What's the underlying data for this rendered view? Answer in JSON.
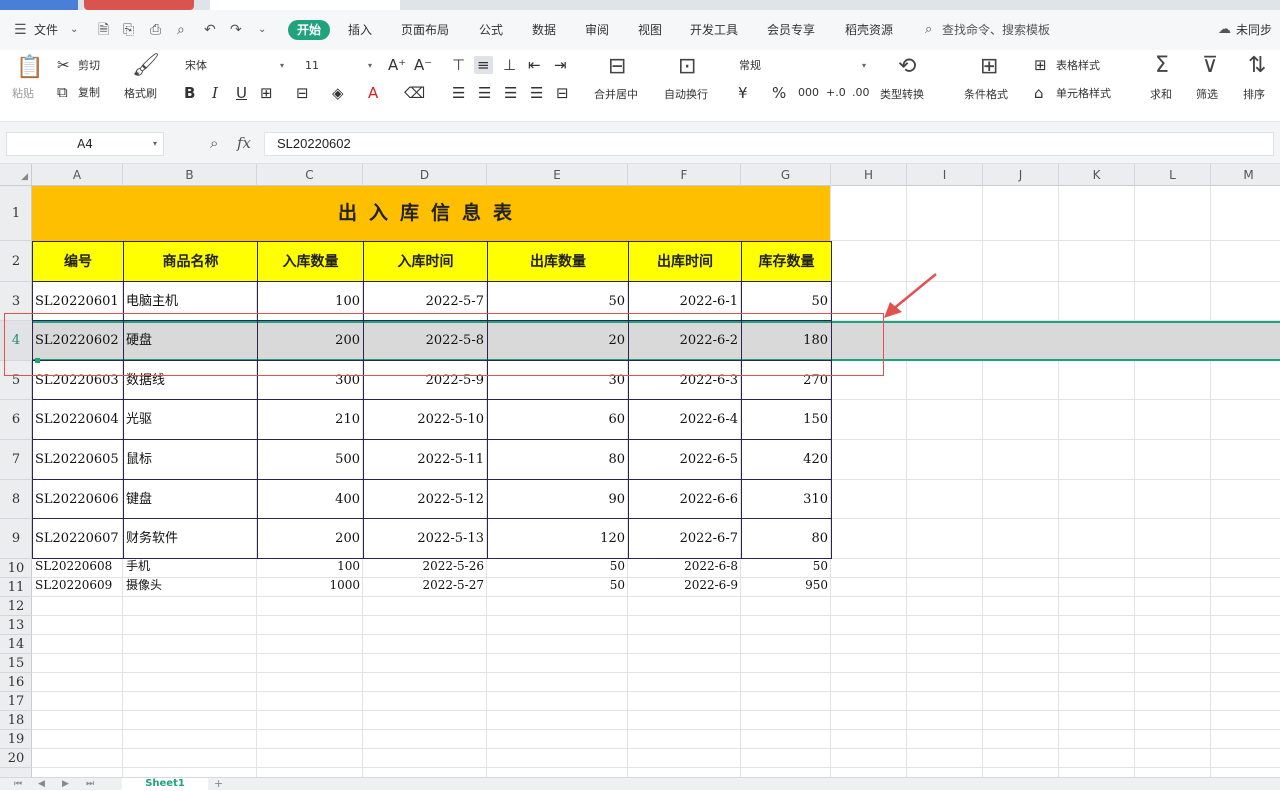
{
  "menu": {
    "file_label": "文件",
    "tabs": [
      "开始",
      "插入",
      "页面布局",
      "公式",
      "数据",
      "审阅",
      "视图",
      "开发工具",
      "会员专享",
      "稻壳资源"
    ],
    "active_tab": "开始",
    "search_placeholder": "查找命令、搜索模板",
    "user_label": "未同步"
  },
  "ribbon": {
    "paste": "粘贴",
    "cut": "剪切",
    "copy": "复制",
    "format_painter": "格式刷",
    "font_name": "宋体",
    "font_size": "11",
    "bold": "B",
    "italic": "I",
    "underline": "U",
    "merge_center": "合并居中",
    "wrap_text": "自动换行",
    "number_format": "常规",
    "type_convert": "类型转换",
    "conditional_format": "条件格式",
    "table_style": "表格样式",
    "cell_style": "单元格样式",
    "sum": "求和",
    "filter": "筛选",
    "sort": "排序"
  },
  "formula_bar": {
    "name_box": "A4",
    "fx": "fx",
    "content": "SL20220602"
  },
  "columns": [
    "A",
    "B",
    "C",
    "D",
    "E",
    "F",
    "G",
    "H",
    "I",
    "J",
    "K",
    "L",
    "M"
  ],
  "rows": [
    "1",
    "2",
    "3",
    "4",
    "5",
    "6",
    "7",
    "8",
    "9",
    "10",
    "11",
    "12",
    "13",
    "14",
    "15",
    "16",
    "17",
    "18",
    "19",
    "20"
  ],
  "table": {
    "title": "出入库信息表",
    "headers": [
      "编号",
      "商品名称",
      "入库数量",
      "入库时间",
      "出库数量",
      "出库时间",
      "库存数量"
    ],
    "rows": [
      [
        "SL20220601",
        "电脑主机",
        "100",
        "2022-5-7",
        "50",
        "2022-6-1",
        "50"
      ],
      [
        "SL20220602",
        "硬盘",
        "200",
        "2022-5-8",
        "20",
        "2022-6-2",
        "180"
      ],
      [
        "SL20220603",
        "数据线",
        "300",
        "2022-5-9",
        "30",
        "2022-6-3",
        "270"
      ],
      [
        "SL20220604",
        "光驱",
        "210",
        "2022-5-10",
        "60",
        "2022-6-4",
        "150"
      ],
      [
        "SL20220605",
        "鼠标",
        "500",
        "2022-5-11",
        "80",
        "2022-6-5",
        "420"
      ],
      [
        "SL20220606",
        "键盘",
        "400",
        "2022-5-12",
        "90",
        "2022-6-6",
        "310"
      ],
      [
        "SL20220607",
        "财务软件",
        "200",
        "2022-5-13",
        "120",
        "2022-6-7",
        "80"
      ],
      [
        "SL20220608",
        "手机",
        "100",
        "2022-5-26",
        "50",
        "2022-6-8",
        "50"
      ],
      [
        "SL20220609",
        "摄像头",
        "1000",
        "2022-5-27",
        "50",
        "2022-6-9",
        "950"
      ]
    ]
  },
  "sheet_tab": "Sheet1",
  "colors": {
    "accent": "#1fa37d",
    "title_fill": "#fdbf00",
    "header_fill": "#ffff00",
    "selection_fill": "#d9d9d9",
    "annotation_red": "#e0524f"
  }
}
